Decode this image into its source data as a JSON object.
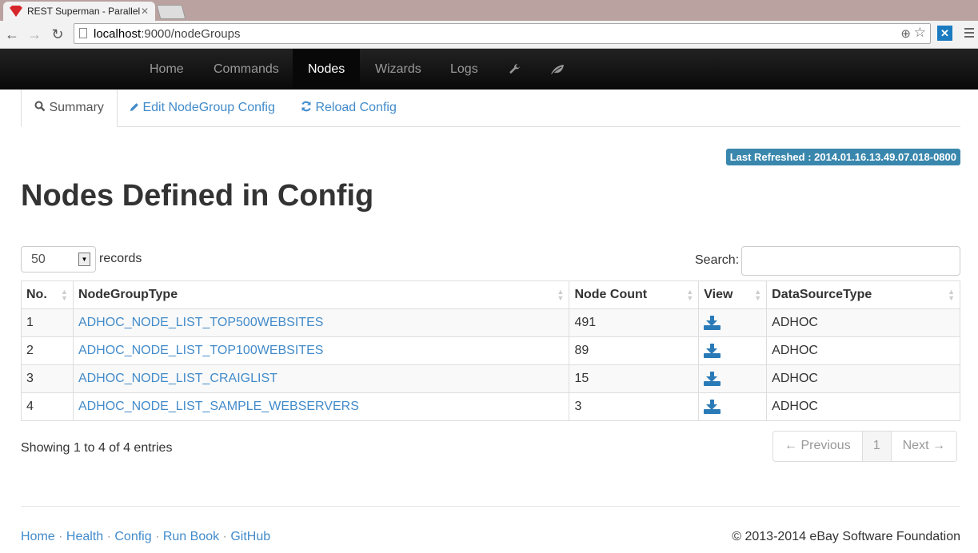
{
  "browser": {
    "tab_title": "REST Superman - Parallel",
    "url_host": "localhost",
    "url_rest": ":9000/nodeGroups"
  },
  "navbar": {
    "items": [
      "Home",
      "Commands",
      "Nodes",
      "Wizards",
      "Logs"
    ],
    "active": "Nodes"
  },
  "subtabs": {
    "summary": "Summary",
    "edit": "Edit NodeGroup Config",
    "reload": "Reload Config"
  },
  "refresh_label": "Last Refreshed : 2014.01.16.13.49.07.018-0800",
  "page_title": "Nodes Defined in Config",
  "length_menu": {
    "value": "50",
    "label": "records"
  },
  "search": {
    "label": "Search:",
    "value": ""
  },
  "table": {
    "headers": [
      "No.",
      "NodeGroupType",
      "Node Count",
      "View",
      "DataSourceType"
    ],
    "rows": [
      {
        "no": "1",
        "type": "ADHOC_NODE_LIST_TOP500WEBSITES",
        "count": "491",
        "source": "ADHOC"
      },
      {
        "no": "2",
        "type": "ADHOC_NODE_LIST_TOP100WEBSITES",
        "count": "89",
        "source": "ADHOC"
      },
      {
        "no": "3",
        "type": "ADHOC_NODE_LIST_CRAIGLIST",
        "count": "15",
        "source": "ADHOC"
      },
      {
        "no": "4",
        "type": "ADHOC_NODE_LIST_SAMPLE_WEBSERVERS",
        "count": "3",
        "source": "ADHOC"
      }
    ]
  },
  "info": "Showing 1 to 4 of 4 entries",
  "pager": {
    "previous": "← Previous",
    "current": "1",
    "next": "Next →"
  },
  "footer": {
    "links": [
      "Home",
      "Health",
      "Config",
      "Run Book",
      "GitHub"
    ],
    "copyright": "© 2013-2014 eBay Software Foundation"
  },
  "colors": {
    "link": "#428bca",
    "navbar": "#111111",
    "label_info": "#3a87ad"
  }
}
